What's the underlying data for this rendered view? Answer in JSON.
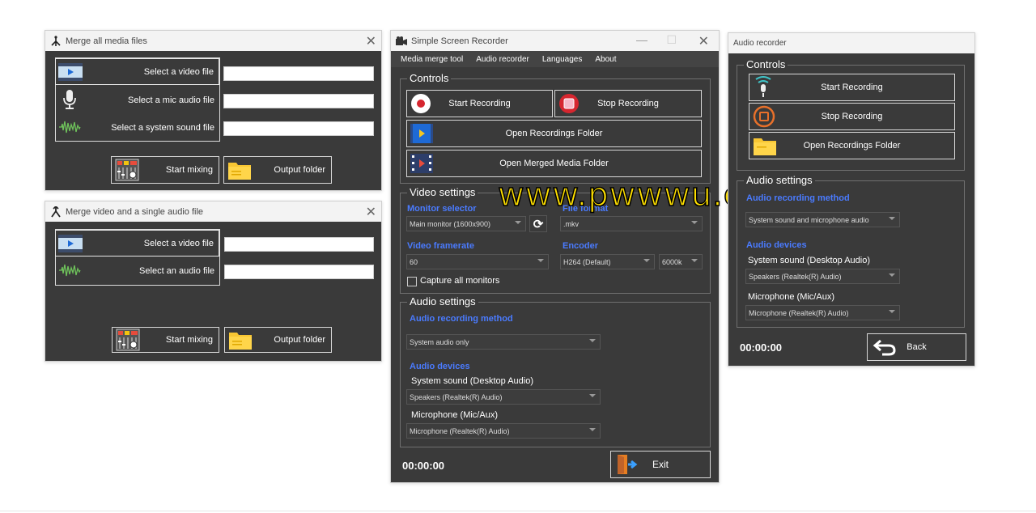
{
  "merge_all": {
    "title": "Merge all media files",
    "rows": [
      "Select a video file",
      "Select a mic audio file",
      "Select a system sound file"
    ],
    "start_mixing": "Start mixing",
    "output_folder": "Output folder"
  },
  "merge_single": {
    "title": "Merge video and a single audio file",
    "rows": [
      "Select a video file",
      "Select an audio file"
    ],
    "start_mixing": "Start mixing",
    "output_folder": "Output folder"
  },
  "main": {
    "title": "Simple Screen Recorder",
    "menu": [
      "Media merge tool",
      "Audio recorder",
      "Languages",
      "About"
    ],
    "controls": {
      "legend": "Controls",
      "start": "Start Recording",
      "stop": "Stop Recording",
      "open_recordings": "Open Recordings Folder",
      "open_merged": "Open Merged Media Folder"
    },
    "video": {
      "legend": "Video settings",
      "monitor_label": "Monitor selector",
      "monitor_value": "Main monitor (1600x900)",
      "format_label": "File format",
      "format_value": ".mkv",
      "framerate_label": "Video framerate",
      "framerate_value": "60",
      "encoder_label": "Encoder",
      "encoder_value": "H264 (Default)",
      "bitrate_value": "6000k",
      "capture_all": "Capture all monitors"
    },
    "audio": {
      "legend": "Audio settings",
      "method_label": "Audio recording method",
      "method_value": "System audio only",
      "devices_label": "Audio devices",
      "system_label": "System sound (Desktop Audio)",
      "system_value": "Speakers (Realtek(R) Audio)",
      "mic_label": "Microphone (Mic/Aux)",
      "mic_value": "Microphone (Realtek(R) Audio)"
    },
    "timer": "00:00:00",
    "exit": "Exit"
  },
  "recorder": {
    "title": "Audio recorder",
    "controls_legend": "Controls",
    "start": "Start Recording",
    "stop": "Stop Recording",
    "open_folder": "Open Recordings Folder",
    "settings_legend": "Audio settings",
    "method_label": "Audio recording method",
    "method_value": "System sound and microphone audio",
    "devices_label": "Audio devices",
    "system_label": "System sound (Desktop Audio)",
    "system_value": "Speakers (Realtek(R) Audio)",
    "mic_label": "Microphone (Mic/Aux)",
    "mic_value": "Microphone (Realtek(R) Audio)",
    "timer": "00:00:00",
    "back": "Back"
  },
  "watermark": "www.pwwwu.com",
  "colors": {
    "window_bg": "#3a3a3a",
    "accent_blue": "#4a7bff",
    "watermark": "#ffe000"
  }
}
